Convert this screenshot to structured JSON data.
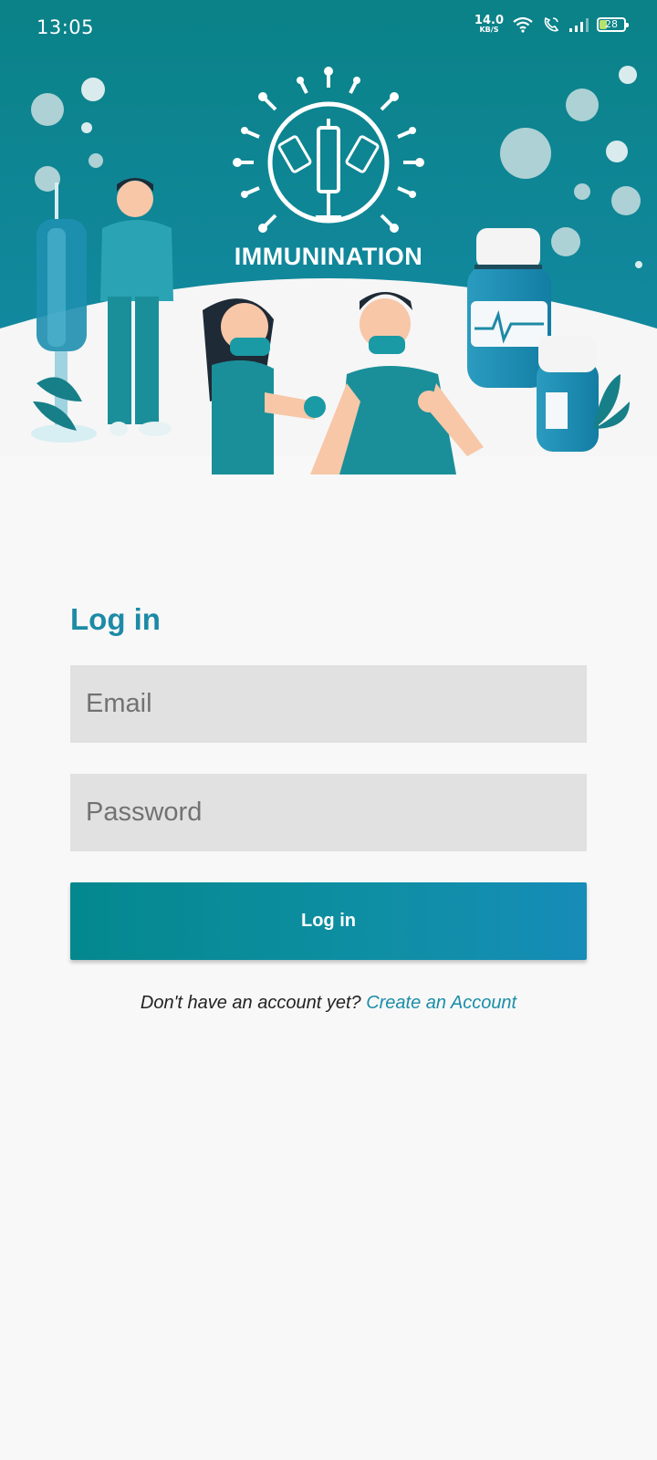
{
  "status_bar": {
    "time": "13:05",
    "net_speed_value": "14.0",
    "net_speed_unit": "KB/S",
    "battery_level": "28",
    "icons": [
      "wifi-icon",
      "volte-call-icon",
      "signal-icon",
      "battery-icon"
    ]
  },
  "hero": {
    "brand_title": "IMMUNINATION",
    "colors": {
      "top": "#0b8289",
      "bottom": "#178cac",
      "ground": "#f6f6f6"
    }
  },
  "login": {
    "title": "Log in",
    "email_placeholder": "Email",
    "password_placeholder": "Password",
    "button_label": "Log in",
    "signup_prompt": "Don't have an account yet?",
    "signup_link": "Create an Account"
  },
  "colors": {
    "accent": "#1d8aa6",
    "field_bg": "#e1e1e1",
    "page_bg": "#f8f8f8"
  }
}
